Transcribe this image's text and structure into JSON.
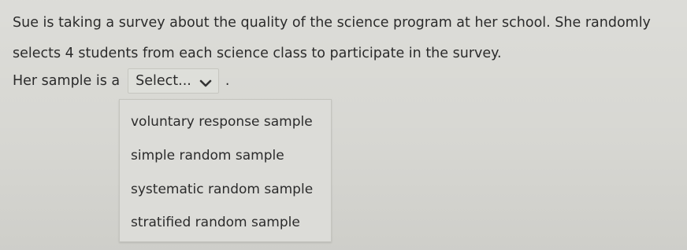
{
  "question": {
    "text": "Sue is taking a survey about the quality of the science program at her school. She randomly selects 4 students from each science class to participate in the survey."
  },
  "answer": {
    "prefix": "Her sample is a",
    "suffix": "."
  },
  "select": {
    "label": "Select...",
    "icon": "chevron-down-icon",
    "options": [
      "voluntary response sample",
      "simple random sample",
      "systematic random sample",
      "stratified random sample"
    ]
  }
}
